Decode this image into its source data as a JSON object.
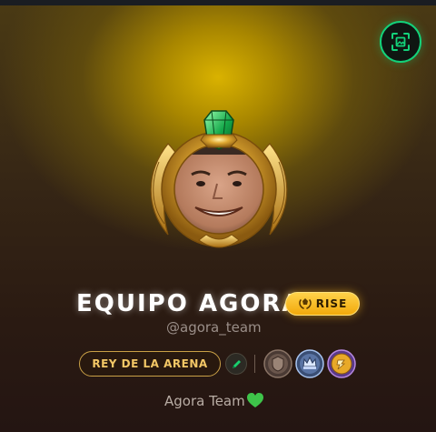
{
  "profile": {
    "display_name": "EQUIPO AGORA",
    "rank_badge": "RISE",
    "handle": "@agora_team",
    "title": "REY DE LA ARENA",
    "bio": "Agora Team"
  },
  "icons": {
    "qr": "qr-scan-icon",
    "rank": "laurel-crown-icon",
    "edit": "pencil-icon",
    "bio_emoji": "green-heart-icon"
  },
  "badges": [
    {
      "name": "bronze-shield-badge"
    },
    {
      "name": "silver-crown-badge"
    },
    {
      "name": "gold-coin-badge"
    }
  ],
  "colors": {
    "accent_green": "#13d27a",
    "rank_gold": "#f2a90b",
    "title_gold": "#f3c766"
  }
}
